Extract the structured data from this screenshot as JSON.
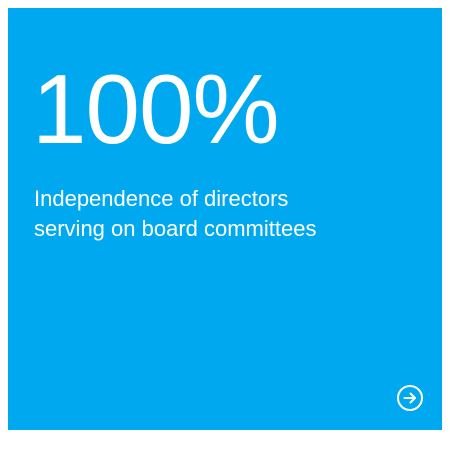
{
  "tile": {
    "stat_value": "100%",
    "description_line1": "Independence of directors",
    "description_line2": "serving on board committees",
    "background_color": "#00a9ef",
    "text_color": "#ffffff",
    "action_icon": "arrow-right-circle-icon"
  }
}
